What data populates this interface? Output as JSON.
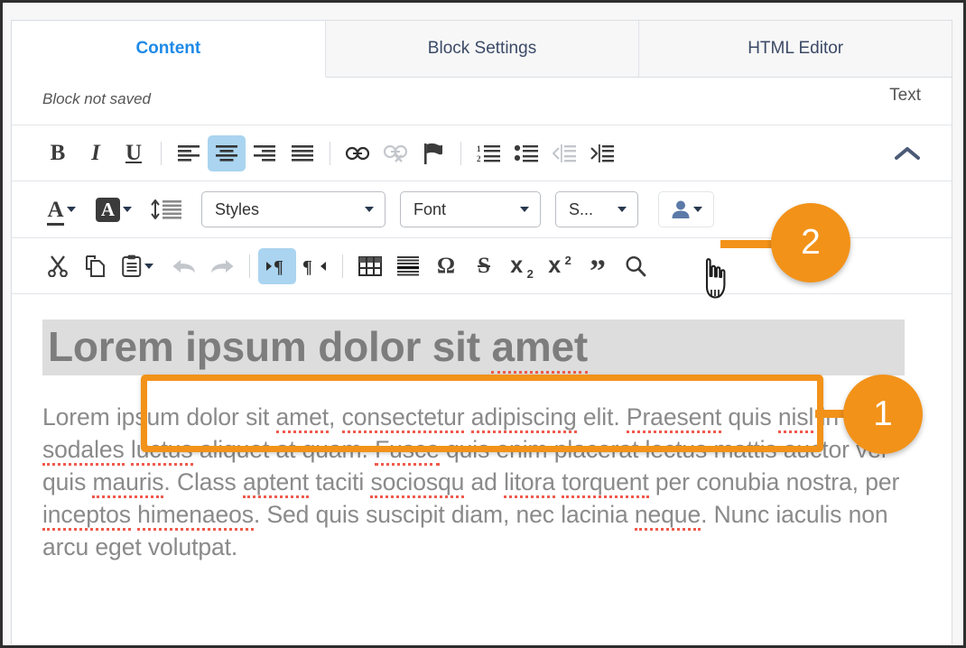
{
  "tabs": [
    {
      "label": "Content",
      "active": true
    },
    {
      "label": "Block Settings",
      "active": false
    },
    {
      "label": "HTML Editor",
      "active": false
    }
  ],
  "status": {
    "block_state": "Block not saved",
    "mode_toggle": "Text"
  },
  "toolbar_row_1": {
    "buttons": [
      {
        "name": "bold-icon",
        "label": "B"
      },
      {
        "name": "italic-icon",
        "label": "I"
      },
      {
        "name": "underline-icon",
        "label": "U"
      },
      {
        "name": "align-left-icon",
        "label": ""
      },
      {
        "name": "align-center-icon",
        "label": ""
      },
      {
        "name": "align-right-icon",
        "label": ""
      },
      {
        "name": "align-justify-icon",
        "label": ""
      },
      {
        "name": "link-icon",
        "label": ""
      },
      {
        "name": "unlink-icon",
        "label": ""
      },
      {
        "name": "anchor-flag-icon",
        "label": ""
      },
      {
        "name": "numbered-list-icon",
        "label": ""
      },
      {
        "name": "bulleted-list-icon",
        "label": ""
      },
      {
        "name": "outdent-icon",
        "label": ""
      },
      {
        "name": "indent-icon",
        "label": ""
      }
    ],
    "collapse_icon": "chevron-up-icon"
  },
  "toolbar_row_2": {
    "text_color_label": "A",
    "bg_color_label": "A",
    "line_height_icon": "line-height-icon",
    "selects": [
      {
        "name": "styles-select",
        "value": "Styles"
      },
      {
        "name": "font-select",
        "value": "Font"
      },
      {
        "name": "size-select",
        "value": "S..."
      }
    ],
    "user_button": "user-icon"
  },
  "toolbar_row_3": {
    "buttons": [
      {
        "name": "cut-icon"
      },
      {
        "name": "copy-icon"
      },
      {
        "name": "paste-icon"
      },
      {
        "name": "undo-icon"
      },
      {
        "name": "redo-icon"
      },
      {
        "name": "text-direction-ltr-icon"
      },
      {
        "name": "text-direction-rtl-icon"
      },
      {
        "name": "table-icon"
      },
      {
        "name": "horizontal-rule-icon"
      },
      {
        "name": "special-character-icon",
        "label": "Ω"
      },
      {
        "name": "strikethrough-icon",
        "label": "S"
      },
      {
        "name": "subscript-icon",
        "label": "x"
      },
      {
        "name": "superscript-icon",
        "label": "x"
      },
      {
        "name": "blockquote-icon",
        "label": "”"
      },
      {
        "name": "search-icon"
      }
    ]
  },
  "content": {
    "heading_plain": "Lorem ipsum dolor sit ",
    "heading_misspelled": "amet",
    "paragraph": "Lorem ipsum dolor sit amet, consectetur adipiscing elit. Praesent quis nisl in turpis sodales luctus aliquet at quam. Fusce quis enim placerat lectus mattis auctor vel quis mauris. Class aptent taciti sociosqu ad litora torquent per conubia nostra, per inceptos himenaeos. Sed quis suscipit diam, nec lacinia neque. Nunc iaculis non arcu eget volutpat."
  },
  "annotations": [
    {
      "name": "annotation-badge-1",
      "number": "1"
    },
    {
      "name": "annotation-badge-2",
      "number": "2"
    }
  ],
  "colors": {
    "accent_orange": "#f29219",
    "active_tab_blue": "#1e8ae8",
    "toolbar_active_blue": "#aad4f0",
    "spellcheck_red": "#ef5a4c"
  }
}
